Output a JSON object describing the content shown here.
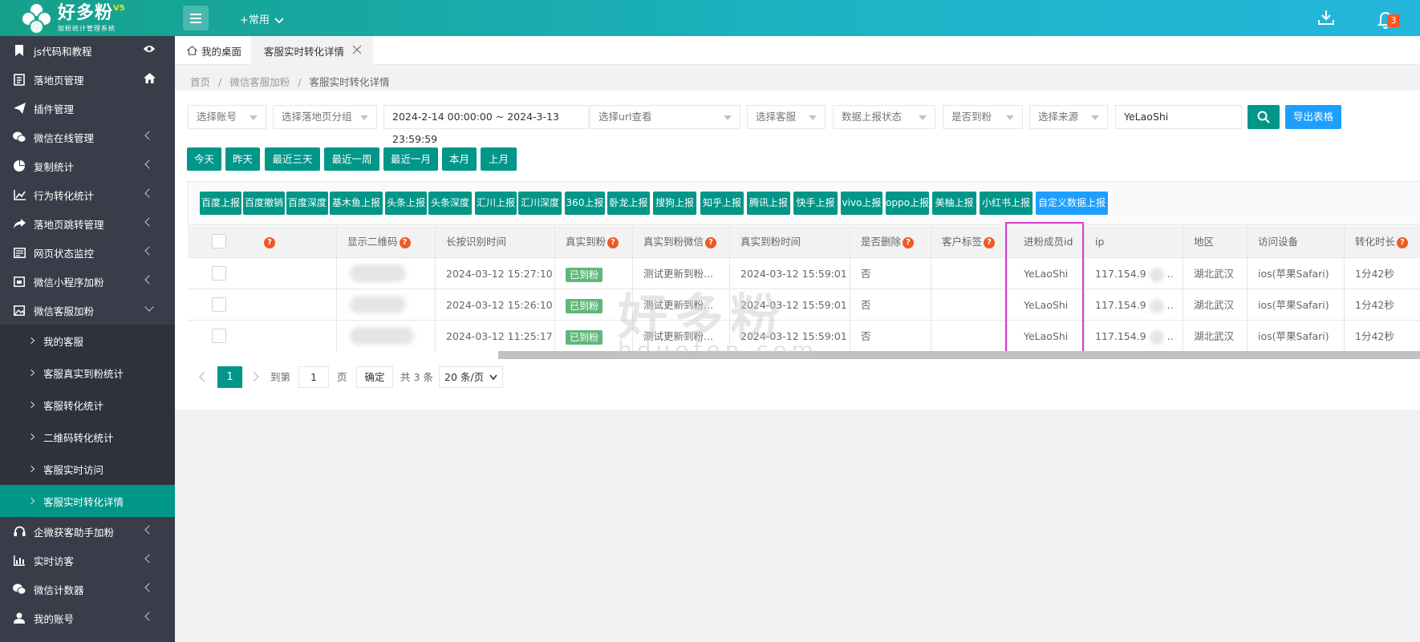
{
  "app": {
    "brand": "好多粉",
    "version": "V5",
    "subtitle": "加粉统计管理系统",
    "common_menu": "+常用",
    "notification_count": "3"
  },
  "sidebar": {
    "items": [
      {
        "label": "js代码和教程",
        "icon": "bookmark-icon"
      },
      {
        "label": "落地页管理",
        "icon": "page-icon"
      },
      {
        "label": "插件管理",
        "icon": "send-icon"
      },
      {
        "label": "微信在线管理",
        "icon": "wechat-icon"
      },
      {
        "label": "复制统计",
        "icon": "pie-icon"
      },
      {
        "label": "行为转化统计",
        "icon": "line-chart-icon"
      },
      {
        "label": "落地页跳转管理",
        "icon": "share-icon"
      },
      {
        "label": "网页状态监控",
        "icon": "monitor-icon"
      },
      {
        "label": "微信小程序加粉",
        "icon": "calendar-icon"
      },
      {
        "label": "微信客服加粉",
        "icon": "image-icon"
      }
    ],
    "sub_items": [
      "我的客服",
      "客服真实到粉统计",
      "客服转化统计",
      "二维码转化统计",
      "客服实时访问",
      "客服实时转化详情"
    ],
    "bottom_items": [
      {
        "label": "企微获客助手加粉",
        "icon": "headset-icon"
      },
      {
        "label": "实时访客",
        "icon": "bar-chart-icon"
      },
      {
        "label": "微信计数器",
        "icon": "wechat-icon"
      },
      {
        "label": "我的账号",
        "icon": "user-icon"
      }
    ]
  },
  "tabs": {
    "home": "我的桌面",
    "current": "客服实时转化详情"
  },
  "breadcrumb": [
    "首页",
    "微信客服加粉",
    "客服实时转化详情"
  ],
  "filters": {
    "account": "选择账号",
    "landing_group": "选择落地页分组",
    "date_range": "2024-2-14 00:00:00 ~ 2024-3-13 23:59:59",
    "url": "选择url查看",
    "service": "选择客服",
    "report_status": "数据上报状态",
    "arrived": "是否到粉",
    "source": "选择来源",
    "keyword": "YeLaoShi",
    "export": "导出表格"
  },
  "quick_dates": [
    "今天",
    "昨天",
    "最近三天",
    "最近一周",
    "最近一月",
    "本月",
    "上月"
  ],
  "report_buttons": [
    "百度上报",
    "百度撤销",
    "百度深度",
    "基木鱼上报",
    "头条上报",
    "头条深度",
    "汇川上报",
    "汇川深度",
    "360上报",
    "卧龙上报",
    "搜狗上报",
    "知乎上报",
    "腾讯上报",
    "快手上报",
    "vivo上报",
    "oppo上报",
    "美柚上报",
    "小红书上报",
    "自定义数据上报"
  ],
  "table": {
    "headers": [
      "显示二维码",
      "长按识别时间",
      "真实到粉",
      "真实到粉微信",
      "真实到粉时间",
      "是否删除",
      "客户标签",
      "进粉成员id",
      "ip",
      "地区",
      "访问设备",
      "转化时长"
    ],
    "rows": [
      {
        "time": "2024-03-12 15:27:10",
        "arrived": "已到粉",
        "wechat": "测试更新到粉...",
        "arrive_time": "2024-03-12 15:59:01",
        "deleted": "否",
        "member": "YeLaoShi",
        "ip": "117.154.9",
        "region": "湖北武汉",
        "device": "ios(苹果Safari)",
        "duration": "1分42秒"
      },
      {
        "time": "2024-03-12 15:26:10",
        "arrived": "已到粉",
        "wechat": "测试更新到粉...",
        "arrive_time": "2024-03-12 15:59:01",
        "deleted": "否",
        "member": "YeLaoShi",
        "ip": "117.154.9",
        "region": "湖北武汉",
        "device": "ios(苹果Safari)",
        "duration": "1分42秒"
      },
      {
        "time": "2024-03-12 11:25:17",
        "arrived": "已到粉",
        "wechat": "测试更新到粉...",
        "arrive_time": "2024-03-12 15:59:01",
        "deleted": "否",
        "member": "YeLaoShi",
        "ip": "117.154.9",
        "region": "湖北武汉",
        "device": "ios(苹果Safari)",
        "duration": "1分42秒"
      }
    ]
  },
  "pagination": {
    "current": "1",
    "goto_label": "到第",
    "goto_value": "1",
    "page_unit": "页",
    "confirm": "确定",
    "total": "共 3 条",
    "page_size": "20 条/页"
  },
  "watermark": {
    "main": "好多粉",
    "sub": "hduofen.com"
  }
}
